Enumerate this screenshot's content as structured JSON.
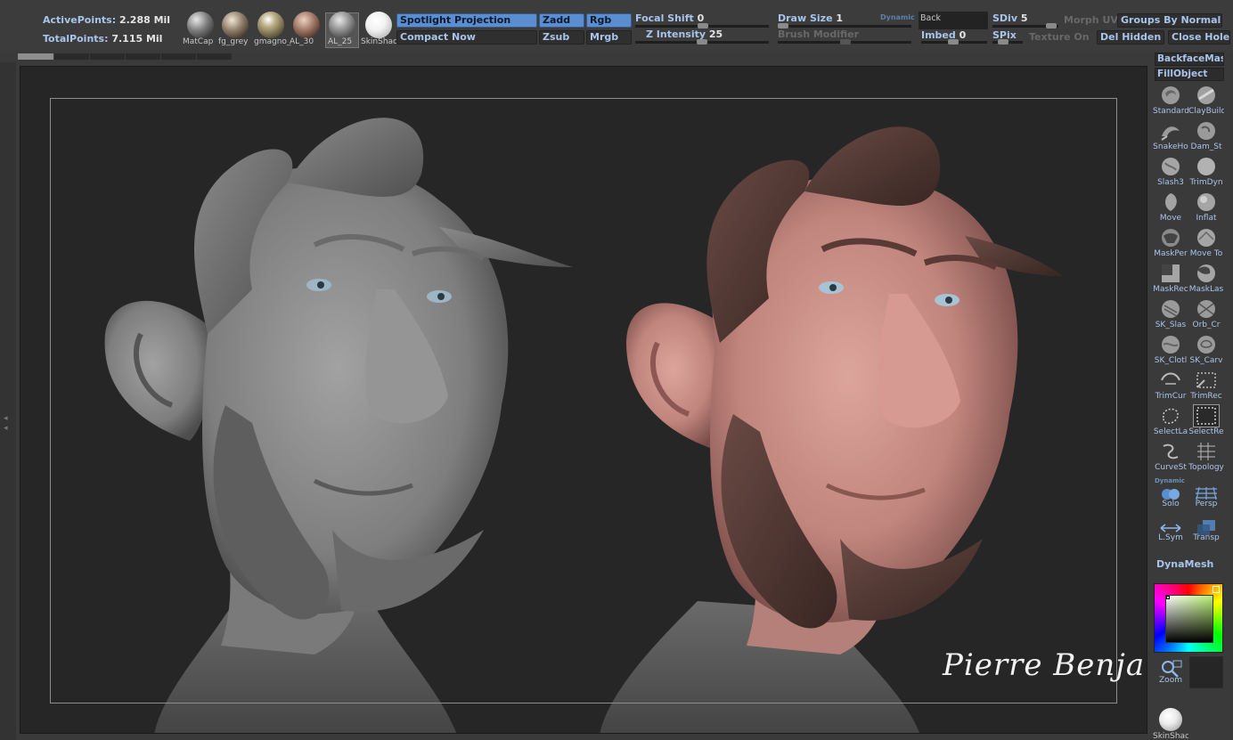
{
  "stats": {
    "active_label": "ActivePoints:",
    "active_value": "2.288 Mil",
    "total_label": "TotalPoints:",
    "total_value": "7.115 Mil"
  },
  "materials": [
    {
      "label": "MatCap",
      "color": "#8a8a8a"
    },
    {
      "label": "fg_grey",
      "color": "#9a8a78"
    },
    {
      "label": "gmagno_",
      "color": "#b0a080"
    },
    {
      "label": "AL_30",
      "color": "#a0806c"
    },
    {
      "label": "AL_25",
      "color": "#9a9a9a"
    },
    {
      "label": "SkinShac",
      "color": "#ffffff"
    }
  ],
  "toolbar": {
    "spotlight": "Spotlight Projection",
    "compact": "Compact Now",
    "zadd": "Zadd",
    "zsub": "Zsub",
    "rgb": "Rgb",
    "mrgb": "Mrgb",
    "focal_label": "Focal Shift",
    "focal_value": "0",
    "zint_label": "Z Intensity",
    "zint_value": "25",
    "draw_label": "Draw Size",
    "draw_value": "1",
    "brushmod_label": "Brush Modifier",
    "dynamic": "Dynamic",
    "back": "Back",
    "imbed_label": "Imbed",
    "imbed_value": "0",
    "sdiv_label": "SDiv",
    "sdiv_value": "5",
    "spix_label": "SPix",
    "morphuv": "Morph UV",
    "texture": "Texture On",
    "groups": "Groups By Normals",
    "delhidden": "Del Hidden",
    "closeholes": "Close Holes"
  },
  "progress": {
    "fraction": 0.17,
    "segments": 6
  },
  "canvas": {
    "signature": "Pierre Benjamin",
    "bg": "#262626",
    "grey_bust": "#8e8e8e",
    "skin": "#c58c84",
    "hair": "#4c3430"
  },
  "shelf": {
    "backface": "BackfaceMas",
    "fillobject": "FillObject",
    "tools": [
      {
        "label": "Standard",
        "icon": "standard-brush-icon"
      },
      {
        "label": "ClayBuild",
        "icon": "claybuildup-brush-icon"
      },
      {
        "label": "SnakeHo",
        "icon": "snakehook-brush-icon"
      },
      {
        "label": "Dam_St",
        "icon": "damstandard-brush-icon"
      },
      {
        "label": "Slash3",
        "icon": "slash3-brush-icon"
      },
      {
        "label": "TrimDyn",
        "icon": "trimdynamic-brush-icon"
      },
      {
        "label": "Move",
        "icon": "move-brush-icon"
      },
      {
        "label": "Inflat",
        "icon": "inflate-brush-icon"
      },
      {
        "label": "MaskPer",
        "icon": "maskpen-brush-icon"
      },
      {
        "label": "Move To",
        "icon": "movetopological-brush-icon"
      },
      {
        "label": "MaskRec",
        "icon": "maskrect-brush-icon"
      },
      {
        "label": "MaskLas",
        "icon": "masklasso-brush-icon"
      },
      {
        "label": "SK_Slas",
        "icon": "sk-slash-brush-icon"
      },
      {
        "label": "Orb_Cr",
        "icon": "orb-cracks-brush-icon"
      },
      {
        "label": "SK_Clotl",
        "icon": "sk-cloth-brush-icon"
      },
      {
        "label": "SK_Carv",
        "icon": "sk-carve-brush-icon"
      },
      {
        "label": "TrimCur",
        "icon": "trimcurve-brush-icon"
      },
      {
        "label": "TrimRec",
        "icon": "trimrect-brush-icon"
      },
      {
        "label": "SelectLa",
        "icon": "selectlasso-brush-icon"
      },
      {
        "label": "SelectRe",
        "icon": "selectrect-brush-icon"
      },
      {
        "label": "CurveSt",
        "icon": "curvestrap-brush-icon"
      },
      {
        "label": "Topology",
        "icon": "topology-brush-icon"
      }
    ],
    "dynamic": "Dynamic",
    "solo": "Solo",
    "persp": "Persp",
    "lsym": "L.Sym",
    "transp": "Transp",
    "dynamesh": "DynaMesh",
    "zoom": "Zoom",
    "skinshade": "SkinShac"
  }
}
